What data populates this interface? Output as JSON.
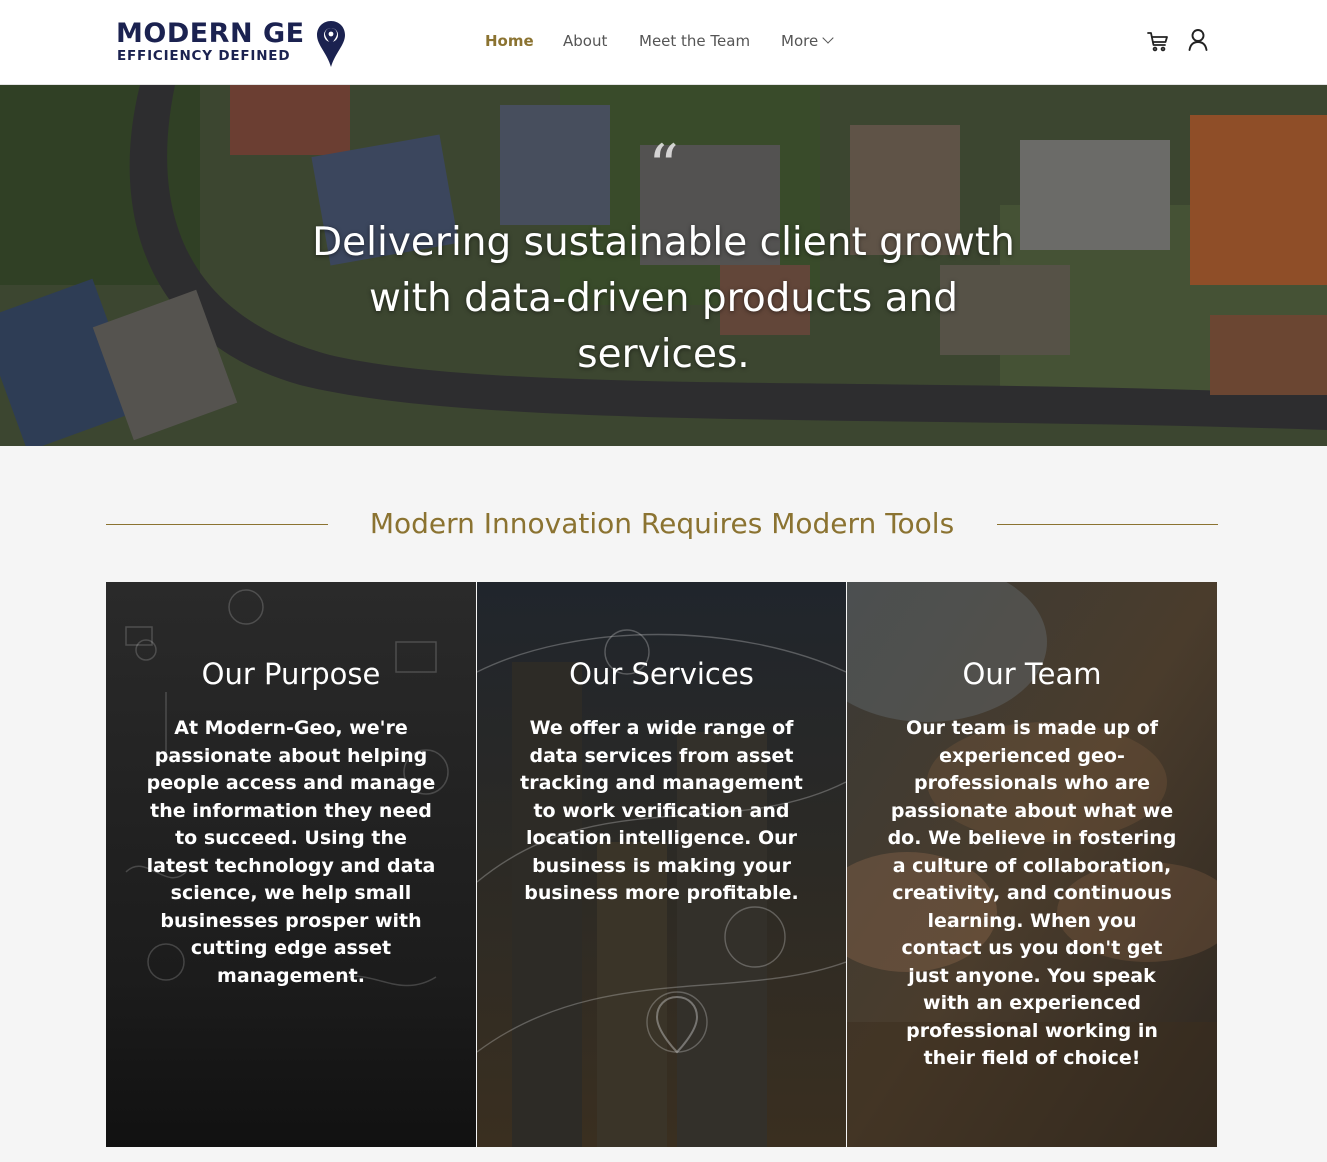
{
  "header": {
    "logo_line1": "MODERN GE",
    "logo_line2": "EFFICIENCY DEFINED",
    "nav": [
      {
        "label": "Home",
        "active": true
      },
      {
        "label": "About"
      },
      {
        "label": "Meet the Team"
      },
      {
        "label": "More"
      }
    ],
    "icons": [
      "cart-icon",
      "user-icon"
    ]
  },
  "hero": {
    "quote_mark": "“",
    "text": "Delivering sustainable client growth with data-driven products and services."
  },
  "section": {
    "title": "Modern Innovation Requires Modern Tools"
  },
  "cards": [
    {
      "title": "Our Purpose",
      "body": "At Modern-Geo, we're passionate about helping people access and manage the information they need to succeed. Using the latest technology and data science, we help small businesses prosper with cutting edge asset management."
    },
    {
      "title": "Our Services",
      "body": "We offer a wide range of data services from asset tracking and management to work verification and location intelligence. Our business is making your business more profitable."
    },
    {
      "title": "Our Team",
      "body": "Our team is made up of experienced geo-professionals who are passionate about what we do. We believe in fostering a culture of collaboration, creativity, and continuous learning. When you contact us you don't get just anyone. You speak with an experienced professional working in their field of choice!"
    }
  ],
  "colors": {
    "brand_navy": "#1b2250",
    "accent_gold": "#8b7331",
    "background": "#f5f5f5"
  }
}
